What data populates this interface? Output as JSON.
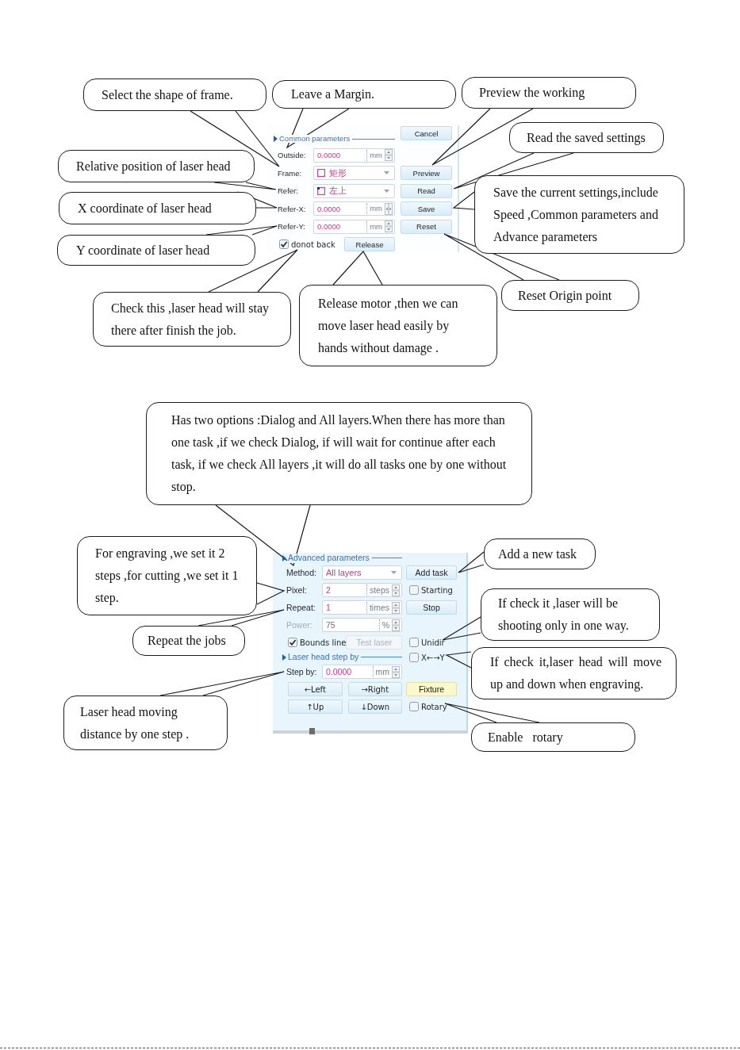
{
  "top_figure": {
    "panel": {
      "rows": [
        {
          "kind": "section",
          "title": "Common parameters",
          "side": {
            "kind": "button",
            "label": "Cancel",
            "highlighted": false
          }
        },
        {
          "kind": "spin",
          "label": "Outside:",
          "value": "0.0000",
          "unit": "mm",
          "disabled": false
        },
        {
          "kind": "shape-select",
          "label": "Frame:",
          "value": "矩形",
          "disabled": false,
          "side": {
            "kind": "button",
            "label": "Preview",
            "highlighted": false
          }
        },
        {
          "kind": "corner-select",
          "label": "Refer:",
          "value": "左上",
          "disabled": false,
          "side": {
            "kind": "button",
            "label": "Read",
            "highlighted": false
          }
        },
        {
          "kind": "horizontal-spin",
          "label": "Refer-X:",
          "value": "0.0000",
          "unit": "mm",
          "disabled": false,
          "side": {
            "kind": "button",
            "label": "Save",
            "highlighted": false
          }
        },
        {
          "kind": "spin",
          "label": "Refer-Y:",
          "value": "0.0000",
          "unit": "mm",
          "disabled": false,
          "side": {
            "kind": "button",
            "label": "Reset",
            "highlighted": false
          }
        },
        {
          "kind": "check-button",
          "check": {
            "label": "donot back",
            "checked": true
          },
          "button": {
            "label": "Release",
            "disabled": false
          }
        }
      ]
    },
    "callouts": [
      "Select the shape of frame.",
      "Leave a Margin.",
      "Preview the working",
      "Read the saved settings",
      "Relative position of laser head",
      "Save the current settings,include Speed ,Common parameters and Advance parameters",
      "X coordinate of laser head",
      "Y coordinate of laser head",
      "Check this ,laser head will stay there after finish the job.",
      "Release motor ,then we can move laser head easily by hands without damage .",
      "Reset Origin point"
    ]
  },
  "bottom_figure": {
    "panel": {
      "rows": [
        {
          "kind": "section",
          "title": "Advanced parameters"
        },
        {
          "kind": "select",
          "label": "Method:",
          "value": "All layers",
          "disabled": false,
          "side": {
            "kind": "button",
            "label": "Add task",
            "highlighted": false
          }
        },
        {
          "kind": "spin",
          "label": "Pixel:",
          "value": "2",
          "unit": "steps",
          "disabled": false,
          "side": {
            "kind": "checkbox",
            "label": "Starting",
            "checked": false
          }
        },
        {
          "kind": "spin",
          "label": "Repeat:",
          "value": "1",
          "unit": "times",
          "disabled": false,
          "side": {
            "kind": "button",
            "label": "Stop",
            "highlighted": false
          }
        },
        {
          "kind": "spin",
          "label": "Power:",
          "value": "75",
          "unit": "%",
          "disabled": true
        },
        {
          "kind": "check-button",
          "check": {
            "label": "Bounds line",
            "checked": true
          },
          "button": {
            "label": "Test laser",
            "disabled": true
          },
          "side": {
            "kind": "checkbox",
            "label": "Unidir",
            "checked": false
          }
        },
        {
          "kind": "section",
          "title": "Laser head step by",
          "side": {
            "kind": "checkbox",
            "label": "X←→Y",
            "checked": false
          }
        },
        {
          "kind": "spin",
          "label": "Step by:",
          "value": "0.0000",
          "unit": "mm",
          "disabled": false
        },
        {
          "kind": "buttons",
          "buttons": [
            "←Left",
            "→Right"
          ],
          "side": {
            "kind": "button",
            "label": "Fixture",
            "highlighted": true
          }
        },
        {
          "kind": "buttons",
          "buttons": [
            "↑Up",
            "↓Down"
          ],
          "side": {
            "kind": "checkbox",
            "label": "Rotary",
            "checked": false
          }
        }
      ]
    },
    "callouts": [
      "Has two options :Dialog and All layers.When there has more than one task ,if we check Dialog, if will wait for continue after each task, if we check All layers ,it will do all tasks one by one without stop.",
      "For engraving ,we set it 2 steps ,for cutting ,we set it 1 step.",
      "Add a new task",
      "If check it ,laser will be shooting only in one way.",
      "Repeat the jobs",
      "If check it,laser head will move up and down when engraving.",
      "Laser head moving distance by one step .",
      "Enable   rotary"
    ]
  }
}
